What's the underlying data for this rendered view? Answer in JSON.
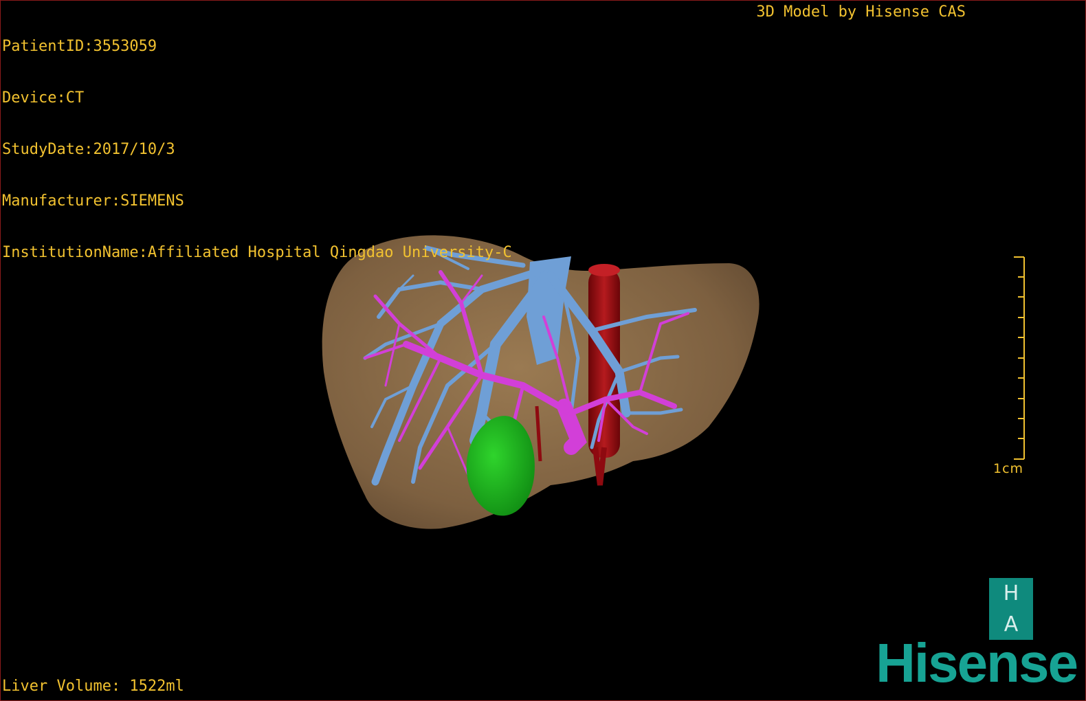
{
  "dicom": {
    "patient_id": "PatientID:3553059",
    "device": "Device:CT",
    "study_date": "StudyDate:2017/10/3",
    "manufacturer": "Manufacturer:SIEMENS",
    "institution": "InstitutionName:Affiliated Hospital Qingdao University-C"
  },
  "caption": "3D Model by Hisense CAS",
  "liver_volume": "Liver Volume: 1522ml",
  "scale": {
    "label": "1cm"
  },
  "badge": {
    "top": "H",
    "bottom": "A"
  },
  "logo": {
    "text": "Hisense"
  },
  "colors": {
    "overlay_text": "#f2c230",
    "liver": "#8a6a45",
    "hepatic_vein": "#6f9fd6",
    "portal_vein": "#d23fd8",
    "vena_cava": "#9a0c12",
    "gallbladder": "#19b51b",
    "brand": "#17a394"
  }
}
